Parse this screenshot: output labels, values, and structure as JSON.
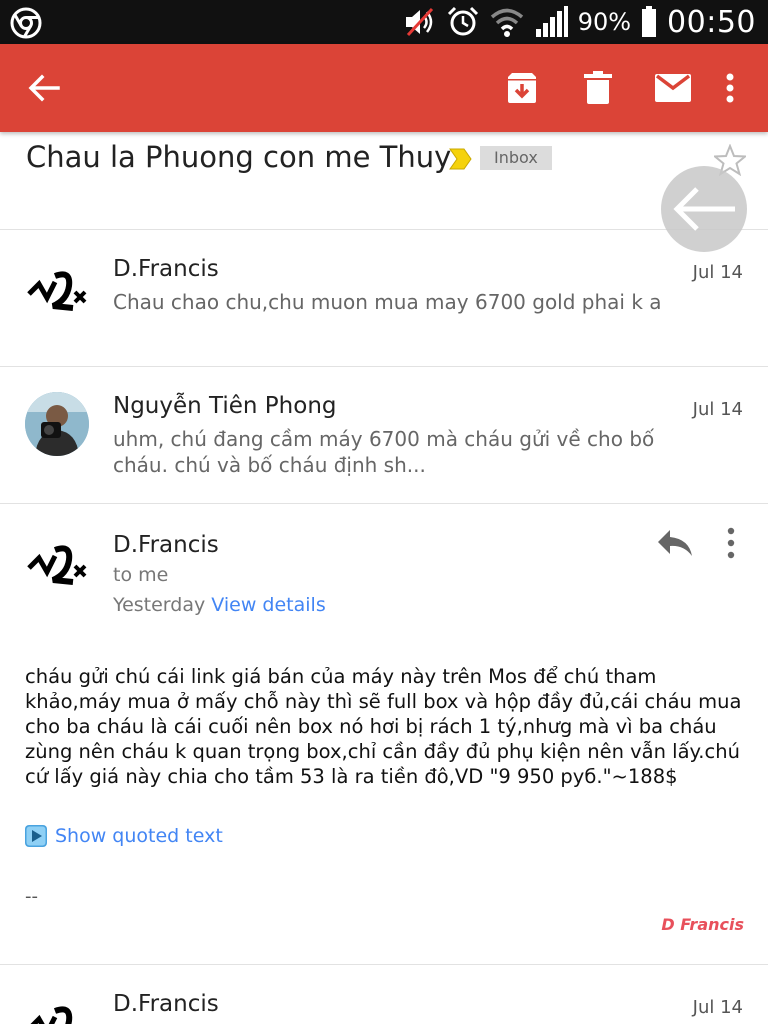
{
  "status_bar": {
    "battery_percent": "90%",
    "time": "00:50",
    "icons": [
      "chrome-icon",
      "mute-icon",
      "alarm-icon",
      "wifi-icon",
      "signal-icon",
      "battery-icon"
    ]
  },
  "app_bar": {
    "color": "#db4437",
    "icons": [
      "back-arrow-icon",
      "archive-icon",
      "delete-icon",
      "mark-unread-icon",
      "more-vert-icon"
    ]
  },
  "thread": {
    "subject": "Chau la Phuong con me Thuy",
    "label": "Inbox"
  },
  "messages": [
    {
      "sender": "D.Francis",
      "date": "Jul 14",
      "snippet": "Chau chao chu,chu muon mua may 6700 gold phai k a"
    },
    {
      "sender": "Nguyễn Tiên Phong",
      "date": "Jul 14",
      "snippet": "uhm, chú đang cầm máy 6700 mà cháu gửi về cho bố cháu. chú và bố cháu định sh..."
    },
    {
      "sender": "D.Francis",
      "to": "to me",
      "when": "Yesterday",
      "view_details": "View details",
      "body": "cháu gửi chú cái link giá bán của máy này trên Mos để chú tham khảo,máy mua ở mấy chỗ này thì sẽ full box và hộp đầy đủ,cái cháu mua cho ba cháu là cái cuối nên box nó hơi bị rách 1 tý,nhưg mà vì ba cháu zùng nên cháu k quan trọng box,chỉ cần đầy đủ phụ kiện nên vẫn lấy.chú cứ lấy giá này chia cho tầm 53 là ra tiền đô,VD \"9 950 руб.\"~188$",
      "show_quoted": "Show quoted text",
      "signature_dash": "--",
      "signature_name": "D Francis"
    },
    {
      "sender": "D.Francis",
      "date": "Jul 14"
    }
  ]
}
